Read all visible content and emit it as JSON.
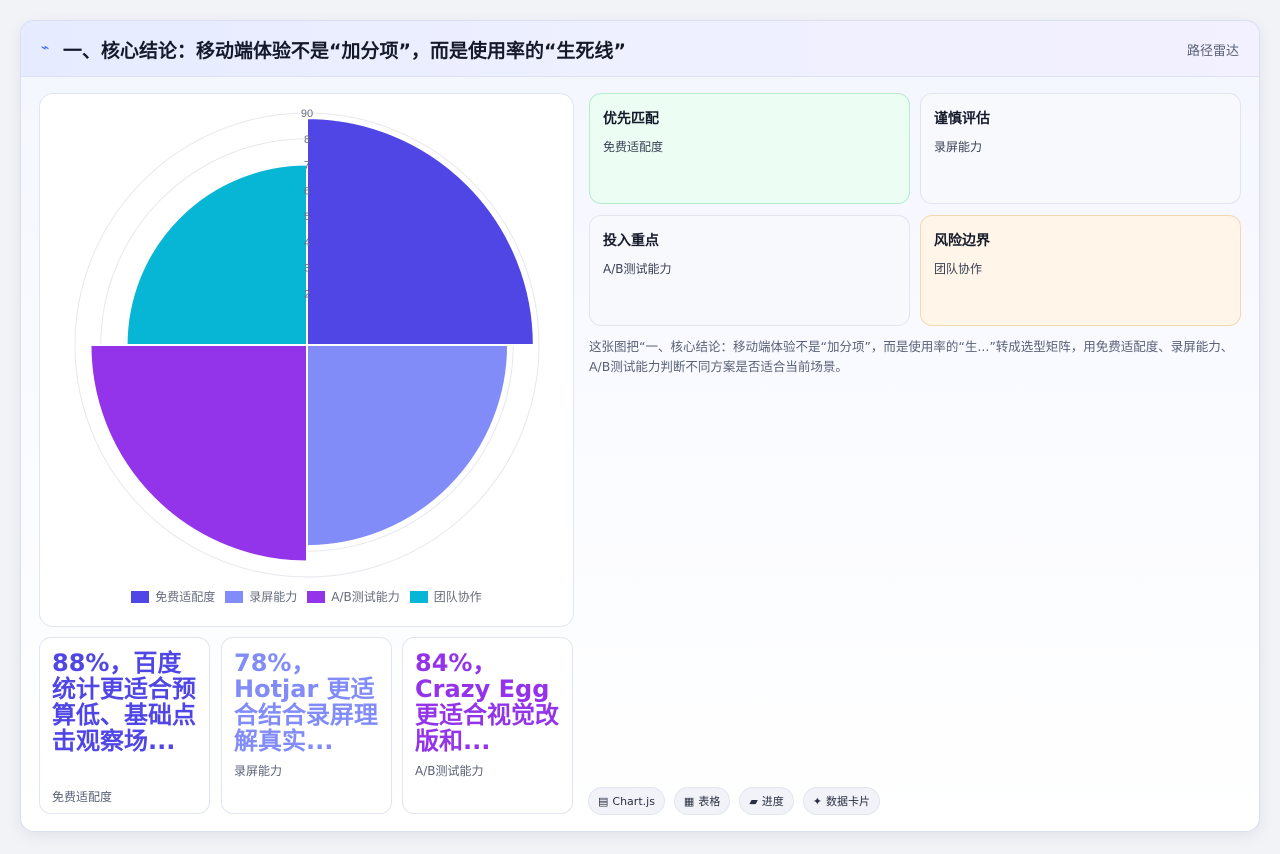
{
  "header": {
    "icon": "lightning-icon",
    "title": "一、核心结论：移动端体验不是“加分项”，而是使用率的“生死线”",
    "right_label": "路径雷达"
  },
  "chart_data": {
    "type": "polarArea",
    "categories": [
      "免费适配度",
      "录屏能力",
      "A/B测试能力",
      "团队协作"
    ],
    "values": [
      88,
      78,
      84,
      70
    ],
    "colors": [
      "#4f46e5",
      "#818cf8",
      "#9333ea",
      "#06b6d4"
    ],
    "r_range": [
      0,
      90
    ],
    "r_ticks": [
      "90",
      "8",
      "7",
      "6",
      "5",
      "4",
      "3",
      "2"
    ],
    "legend_position": "bottom",
    "start_angle_deg": 0
  },
  "stats": [
    {
      "value": "88%，百度统计更适合预算低、基础点击观察场...",
      "label": "免费适配度",
      "color": "#4f46e5"
    },
    {
      "value": "78%，Hotjar 更适合结合录屏理解真实...",
      "label": "录屏能力",
      "color": "#818cf8"
    },
    {
      "value": "84%，Crazy Egg 更适合视觉改版和...",
      "label": "A/B测试能力",
      "color": "#9333ea"
    }
  ],
  "matrix": [
    {
      "title": "优先匹配",
      "sub": "免费适配度",
      "tone": "green"
    },
    {
      "title": "谨慎评估",
      "sub": "录屏能力",
      "tone": "neutral"
    },
    {
      "title": "投入重点",
      "sub": "A/B测试能力",
      "tone": "neutral"
    },
    {
      "title": "风险边界",
      "sub": "团队协作",
      "tone": "orange"
    }
  ],
  "summary": "这张图把“一、核心结论：移动端体验不是“加分项”，而是使用率的“生...”转成选型矩阵，用免费适配度、录屏能力、A/B测试能力判断不同方案是否适合当前场景。",
  "badges": [
    {
      "icon": "table-icon",
      "glyph": "▤",
      "label": "Chart.js"
    },
    {
      "icon": "grid-icon",
      "glyph": "▦",
      "label": "表格"
    },
    {
      "icon": "progress-icon",
      "glyph": "▰",
      "label": "进度"
    },
    {
      "icon": "sparkle-icon",
      "glyph": "✦",
      "label": "数据卡片"
    }
  ]
}
